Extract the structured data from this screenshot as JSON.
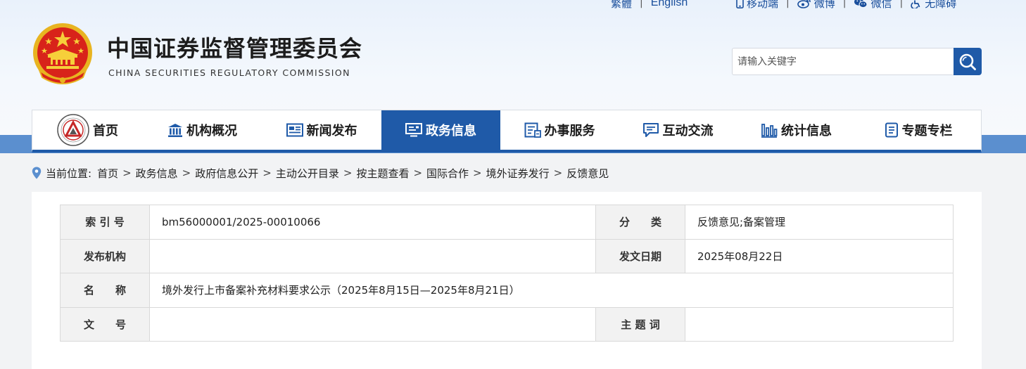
{
  "top_links": {
    "traditional": "繁體",
    "english": "English",
    "mobile": "移动端",
    "weibo": "微博",
    "wechat": "微信",
    "accessibility": "无障碍"
  },
  "site": {
    "title_cn": "中国证券监督管理委员会",
    "title_en": "CHINA SECURITIES REGULATORY COMMISSION"
  },
  "search": {
    "placeholder": "请输入关键字"
  },
  "nav": {
    "items": [
      {
        "label": "首页",
        "icon": "csrc-badge-icon"
      },
      {
        "label": "机构概况",
        "icon": "building-icon"
      },
      {
        "label": "新闻发布",
        "icon": "newspaper-icon"
      },
      {
        "label": "政务信息",
        "icon": "monitor-icon"
      },
      {
        "label": "办事服务",
        "icon": "form-icon"
      },
      {
        "label": "互动交流",
        "icon": "chat-icon"
      },
      {
        "label": "统计信息",
        "icon": "bar-chart-icon"
      },
      {
        "label": "专题专栏",
        "icon": "document-icon"
      }
    ],
    "active_index": 3
  },
  "breadcrumb": {
    "prefix": "当前位置:",
    "items": [
      "首页",
      "政务信息",
      "政府信息公开",
      "主动公开目录",
      "按主题查看",
      "国际合作",
      "境外证券发行",
      "反馈意见"
    ],
    "separator": ">"
  },
  "meta_table": {
    "index_label": "索 引 号",
    "index_value": "bm56000001/2025-00010066",
    "category_label": "分　　类",
    "category_value": "反馈意见;备案管理",
    "issuer_label": "发布机构",
    "issuer_value": "",
    "date_label": "发文日期",
    "date_value": "2025年08月22日",
    "name_label": "名　　称",
    "name_value": "境外发行上市备案补充材料要求公示（2025年8月15日—2025年8月21日）",
    "docno_label": "文　　号",
    "docno_value": "",
    "keywords_label": "主 题 词",
    "keywords_value": ""
  },
  "colors": {
    "primary_blue": "#1f5aa8",
    "band_blue": "#5b8fcf",
    "emblem_red": "#d8231a",
    "emblem_gold": "#f2c230"
  }
}
